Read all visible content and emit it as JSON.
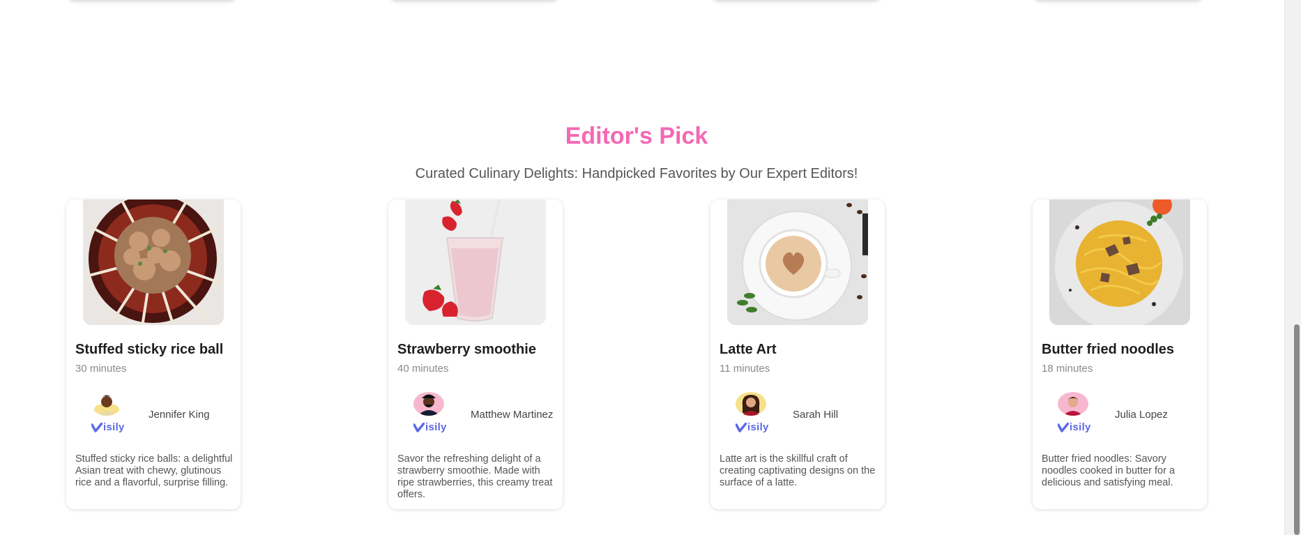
{
  "section": {
    "title": "Editor's Pick",
    "subtitle": "Curated Culinary Delights: Handpicked Favorites by Our Expert Editors!"
  },
  "brand_name": "isily",
  "colors": {
    "accent": "#f468b4",
    "brand": "#5b6ae6"
  },
  "cards": [
    {
      "title": "Stuffed sticky rice ball",
      "time": "30 minutes",
      "author": "Jennifer King",
      "description": "Stuffed sticky rice balls: a delightful Asian treat with chewy, glutinous rice and a flavorful, surprise filling.",
      "image": "rice-ball-dish-photo",
      "avatar_bg": "#f7e08a"
    },
    {
      "title": "Strawberry smoothie",
      "time": "40 minutes",
      "author": "Matthew Martinez",
      "description": "Savor the refreshing delight of a strawberry smoothie. Made with ripe strawberries, this creamy treat offers.",
      "image": "strawberry-smoothie-photo",
      "avatar_bg": "#f7b7cf"
    },
    {
      "title": "Latte Art",
      "time": "11 minutes",
      "author": "Sarah Hill",
      "description": "Latte art is the skillful craft of creating captivating designs on the surface of a latte.",
      "image": "latte-art-photo",
      "avatar_bg": "#f7e08a"
    },
    {
      "title": "Butter fried noodles",
      "time": "18 minutes",
      "author": "Julia Lopez",
      "description": "Butter fried noodles: Savory noodles cooked in butter for a delicious and satisfying meal.",
      "image": "butter-noodles-photo",
      "avatar_bg": "#f7b7cf"
    }
  ]
}
